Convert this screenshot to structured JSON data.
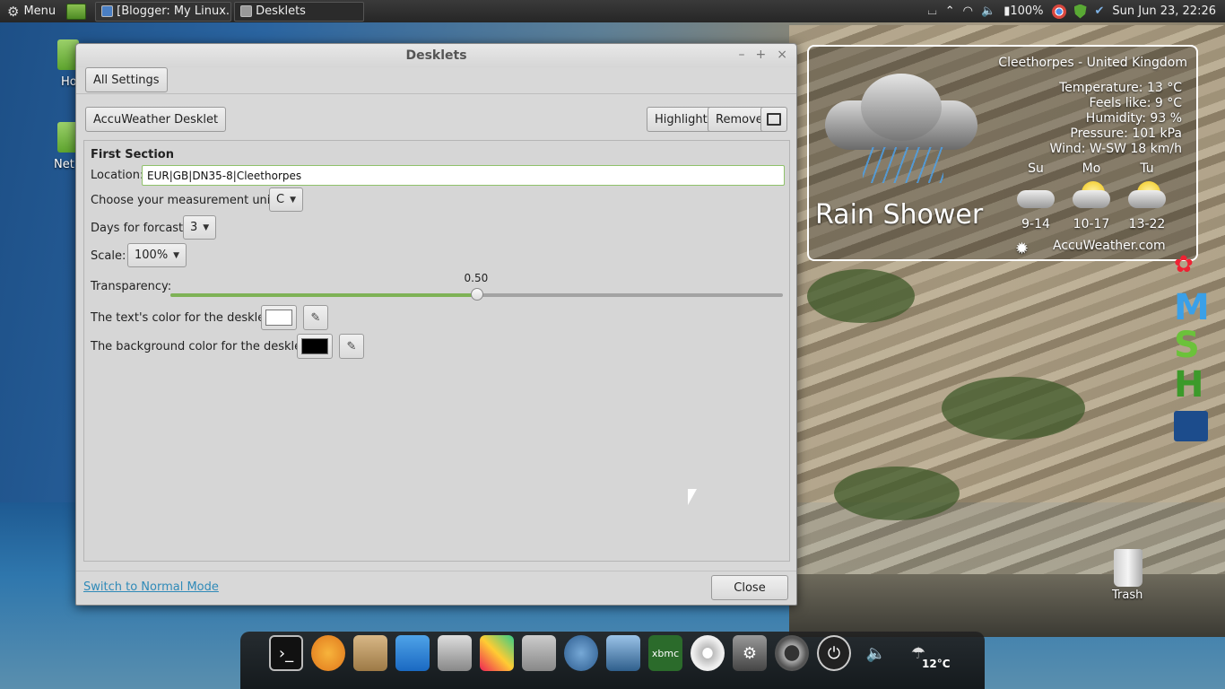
{
  "top_panel": {
    "menu_label": "Menu",
    "tasks": [
      {
        "label": "[Blogger: My Linux..."
      },
      {
        "label": "Desklets"
      }
    ],
    "battery": "100%",
    "clock": "Sun Jun 23, 22:26"
  },
  "desktop": {
    "left_icons": [
      "Ho",
      "Net"
    ],
    "trash_label": "Trash"
  },
  "window": {
    "title": "Desklets",
    "all_settings_label": "All Settings",
    "desklet_name_label": "AccuWeather Desklet",
    "highlight_label": "Highlight",
    "remove_label": "Remove",
    "section_title": "First Section",
    "location": {
      "label": "Location:",
      "value": "EUR|GB|DN35-8|Cleethorpes"
    },
    "unit": {
      "label": "Choose your measurement unit:",
      "value": "C"
    },
    "days": {
      "label": "Days for forcast:",
      "value": "3"
    },
    "scale": {
      "label": "Scale:",
      "value": "100%"
    },
    "transparency": {
      "label": "Transparency:",
      "value": "0.50",
      "fraction": 0.5
    },
    "text_color": {
      "label": "The text's color for the desklet:",
      "color": "#ffffff"
    },
    "bg_color": {
      "label": "The background color for the desklet:",
      "color": "#000000"
    },
    "normal_mode_link": "Switch to Normal Mode",
    "close_label": "Close"
  },
  "weather_desklet": {
    "location": "Cleethorpes - United Kingdom",
    "temperature": "Temperature: 13 °C",
    "feels_like": "Feels like: 9 °C",
    "humidity": "Humidity: 93 %",
    "pressure": "Pressure: 101 kPa",
    "wind": "Wind: W-SW 18 km/h",
    "condition": "Rain Shower",
    "forecast": [
      {
        "day": "Su",
        "range": "9-14",
        "icon": "rain-cloud-icon"
      },
      {
        "day": "Mo",
        "range": "10-17",
        "icon": "sun-cloud-icon"
      },
      {
        "day": "Tu",
        "range": "13-22",
        "icon": "sun-cloud-icon"
      }
    ],
    "source": "AccuWeather.com"
  },
  "dock": {
    "temperature": "12°C"
  },
  "colors": {
    "accent_green": "#7eb256",
    "link_blue": "#2f8ab8"
  }
}
